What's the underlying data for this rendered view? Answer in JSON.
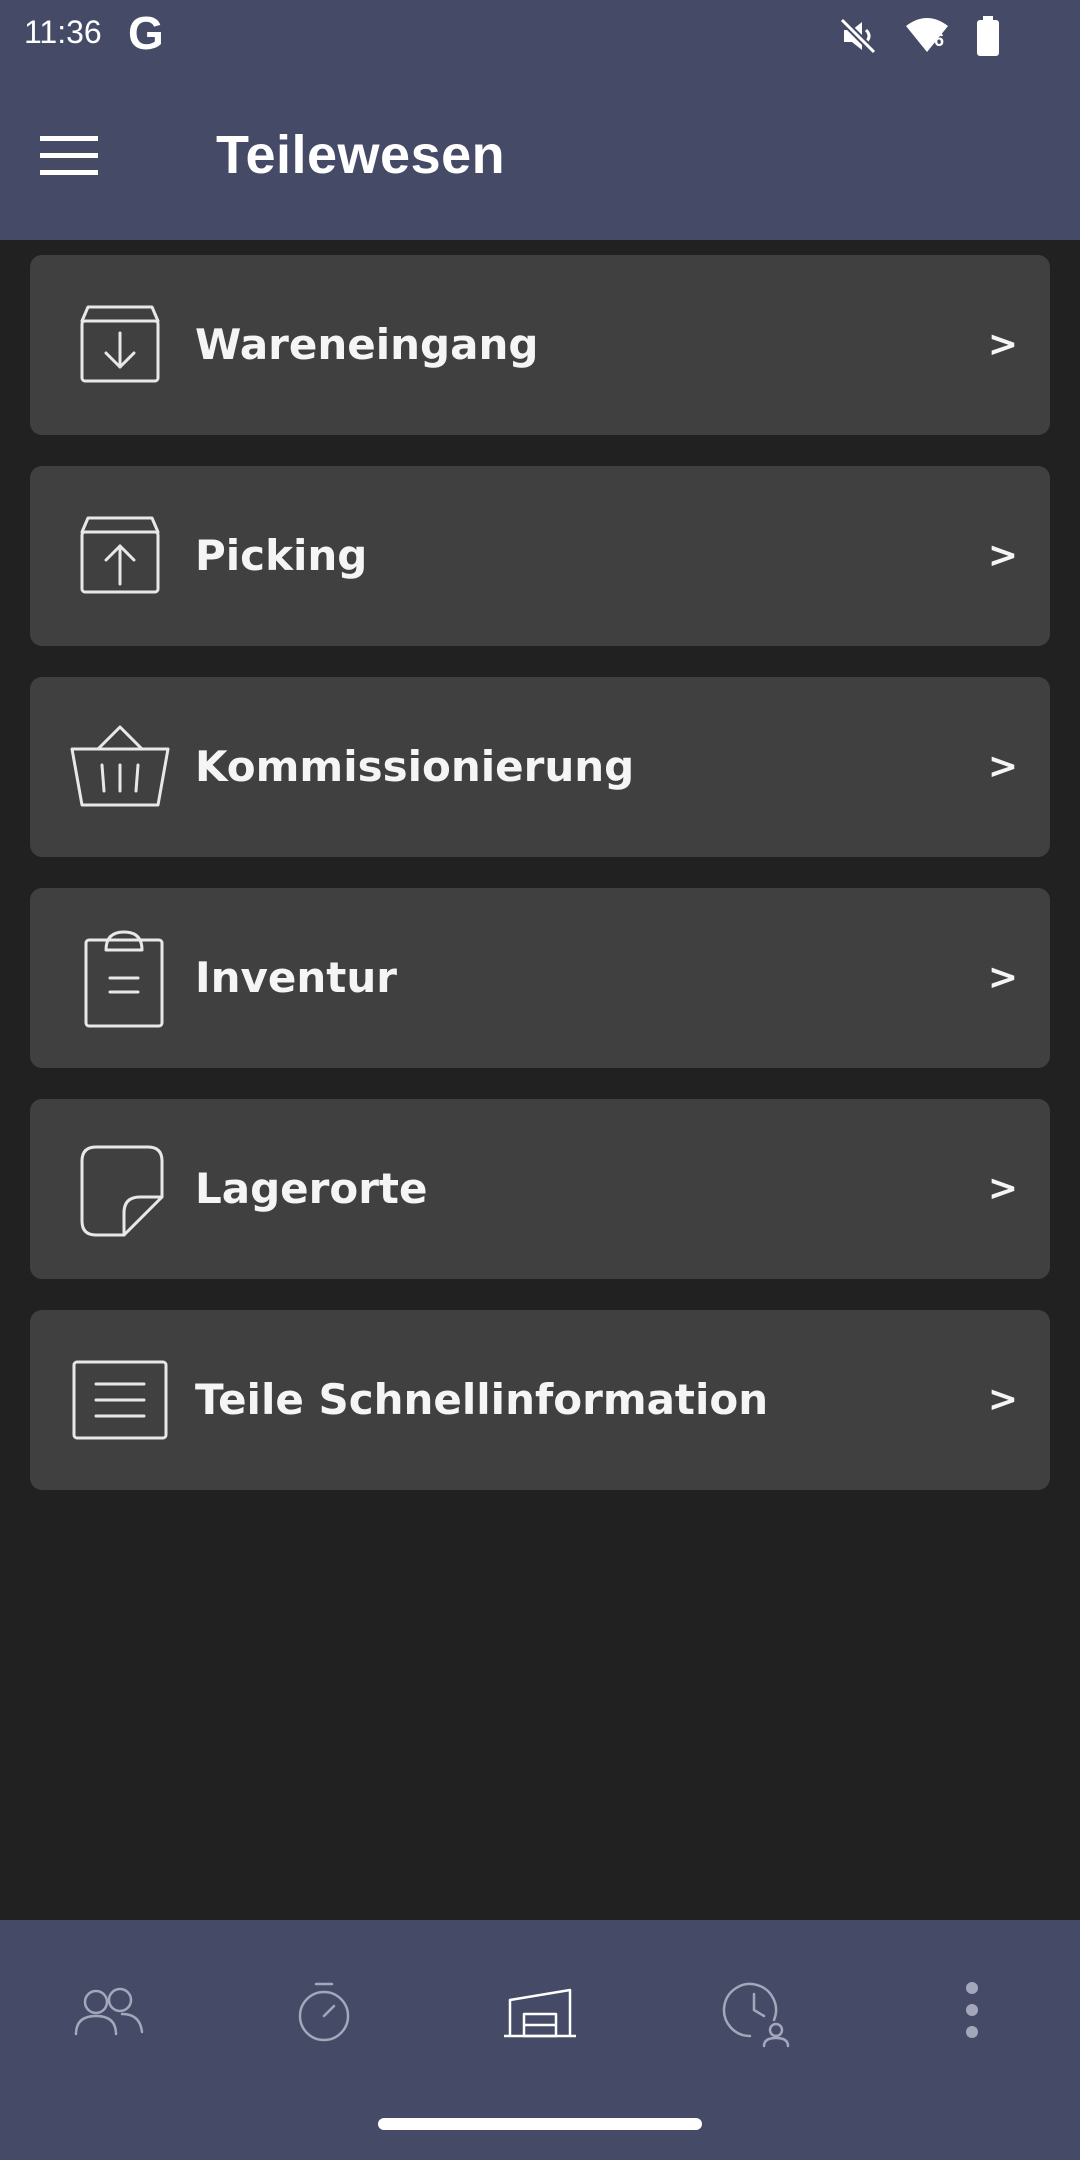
{
  "status_bar": {
    "time": "11:36",
    "google_glyph": "G",
    "wifi_badge": "6",
    "icons": [
      "google-icon",
      "mute-icon",
      "wifi-icon",
      "battery-icon"
    ]
  },
  "app_bar": {
    "title": "Teilewesen",
    "menu_icon": "hamburger-menu-icon"
  },
  "menu": {
    "items": [
      {
        "label": "Wareneingang",
        "icon": "box-in-icon",
        "chevron": ">"
      },
      {
        "label": "Picking",
        "icon": "box-out-icon",
        "chevron": ">"
      },
      {
        "label": "Kommissionierung",
        "icon": "basket-icon",
        "chevron": ">"
      },
      {
        "label": "Inventur",
        "icon": "clipboard-icon",
        "chevron": ">"
      },
      {
        "label": "Lagerorte",
        "icon": "sticky-note-icon",
        "chevron": ">"
      },
      {
        "label": "Teile Schnellinformation",
        "icon": "list-document-icon",
        "chevron": ">"
      }
    ]
  },
  "bottom_nav": {
    "items": [
      {
        "icon": "people-icon"
      },
      {
        "icon": "stopwatch-icon"
      },
      {
        "icon": "warehouse-icon",
        "active": true
      },
      {
        "icon": "clock-person-icon"
      },
      {
        "icon": "more-vertical-icon"
      }
    ]
  },
  "colors": {
    "bar": "#454a66",
    "background": "#212121",
    "card": "#404040",
    "nav_active": "#ffffff",
    "nav_inactive": "#a4a7bb"
  }
}
